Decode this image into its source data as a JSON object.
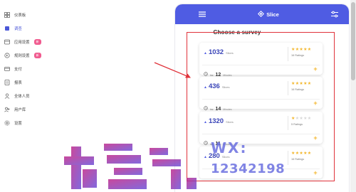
{
  "sidebar": {
    "items": [
      {
        "label": "仪表板",
        "icon": "grid-icon",
        "badge": ""
      },
      {
        "label": "调查",
        "icon": "survey-icon",
        "badge": ""
      },
      {
        "label": "应用设置",
        "icon": "app-settings-icon",
        "badge": "新"
      },
      {
        "label": "规则设置",
        "icon": "rules-icon",
        "badge": "新"
      },
      {
        "label": "支付",
        "icon": "payment-icon",
        "badge": ""
      },
      {
        "label": "报表",
        "icon": "report-icon",
        "badge": ""
      },
      {
        "label": "全体人员",
        "icon": "users-icon",
        "badge": ""
      },
      {
        "label": "用户库",
        "icon": "user-library-icon",
        "badge": ""
      },
      {
        "label": "设置",
        "icon": "gear-icon",
        "badge": ""
      }
    ]
  },
  "app": {
    "brand": "Slice",
    "title": "Choose a survey"
  },
  "cards": [
    {
      "value": "1032",
      "unit": "Slices",
      "stars": 5,
      "ratings": "16 Ratings",
      "time_prefix": "inc",
      "time": "12",
      "time_unit": "Minutes"
    },
    {
      "value": "436",
      "unit": "Slices",
      "stars": 5,
      "ratings": "16 Ratings",
      "time_prefix": "inc",
      "time": "14",
      "time_unit": "Minutes"
    },
    {
      "value": "1320",
      "unit": "Slices",
      "stars": 1,
      "ratings": "5 Ratings",
      "time_prefix": "inc",
      "time": "11",
      "time_unit": "Minutes"
    },
    {
      "value": "280",
      "unit": "Slices",
      "stars": 5,
      "ratings": "16 Ratings",
      "time_prefix": "inc",
      "time": "",
      "time_unit": ""
    }
  ],
  "watermark": {
    "line1": "WX:",
    "line2": "12342198"
  },
  "colors": {
    "accent": "#4f5ce3",
    "star": "#f3b62b",
    "highlight": "#e0323a"
  }
}
